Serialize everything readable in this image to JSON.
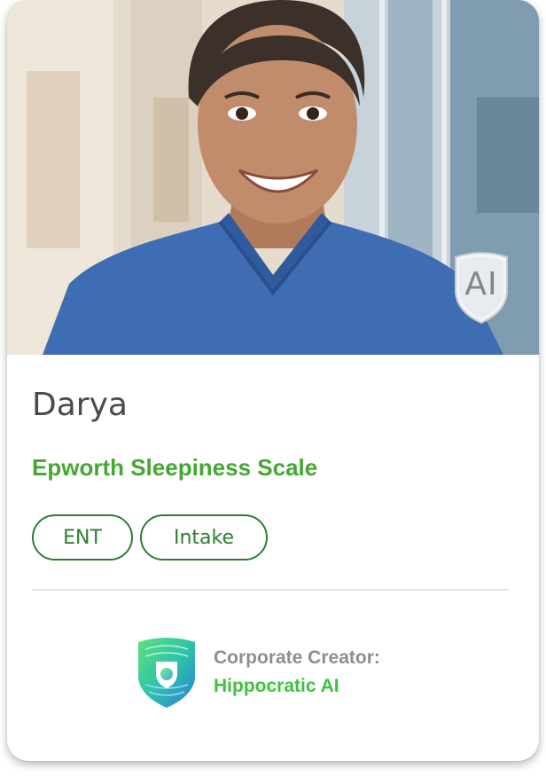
{
  "profile": {
    "name": "Darya",
    "assessment": "Epworth Sleepiness Scale",
    "ai_badge": "AI",
    "tags": [
      "ENT",
      "Intake"
    ]
  },
  "creator": {
    "label": "Corporate Creator:",
    "name": "Hippocratic AI"
  },
  "colors": {
    "accent_green": "#43a830",
    "tag_green": "#2e7d32",
    "creator_green": "#3cc23c",
    "scrubs_blue": "#3f6db3"
  },
  "icons": {
    "photo": "profile-photo",
    "badge": "ai-shield-icon",
    "logo": "hippocratic-shield-logo-icon"
  }
}
